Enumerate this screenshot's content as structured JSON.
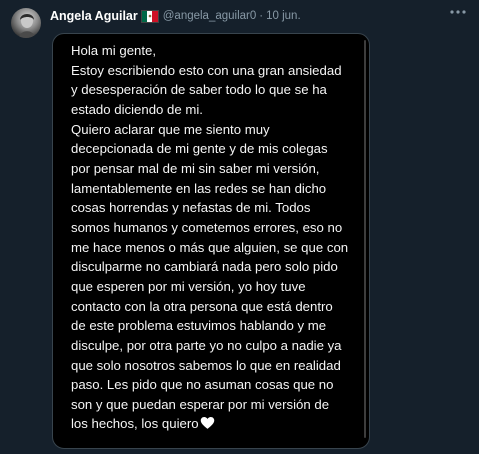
{
  "tweet": {
    "author_name": "Angela Aguilar",
    "author_handle": "@angela_aguilar0",
    "separator": "·",
    "date": "10 jun.",
    "flag_colors": [
      "#006847",
      "#ffffff",
      "#ce1126"
    ],
    "more_icon": "more-horizontal-icon",
    "avatar_icon": "profile-avatar",
    "heart_emoji": "white-heart-emoji"
  },
  "note": {
    "lines": [
      "Hola mi gente,",
      "Estoy escribiendo esto con una gran ansiedad",
      "y desesperación de saber todo lo que se ha",
      "estado diciendo de mi.",
      "Quiero aclarar que me siento muy",
      "decepcionada de mi gente y de mis colegas",
      "por pensar mal de mi sin saber mi versión,",
      "lamentablemente en las redes se han dicho",
      "cosas horrendas y nefastas de mi. Todos",
      "somos humanos y cometemos errores, eso no",
      "me hace menos o más que alguien, se que con",
      "disculparme no cambiará nada pero solo pido",
      "que esperen por mi versión, yo hoy tuve",
      "contacto con la otra persona que está dentro",
      "de este problema estuvimos hablando y me",
      "disculpe, por otra parte yo no culpo a nadie ya",
      "que solo nosotros sabemos lo que en realidad",
      "paso. Les pido que no asuman cosas que no",
      "son y que puedan esperar por mi versión de",
      "los hechos, los quiero"
    ]
  }
}
